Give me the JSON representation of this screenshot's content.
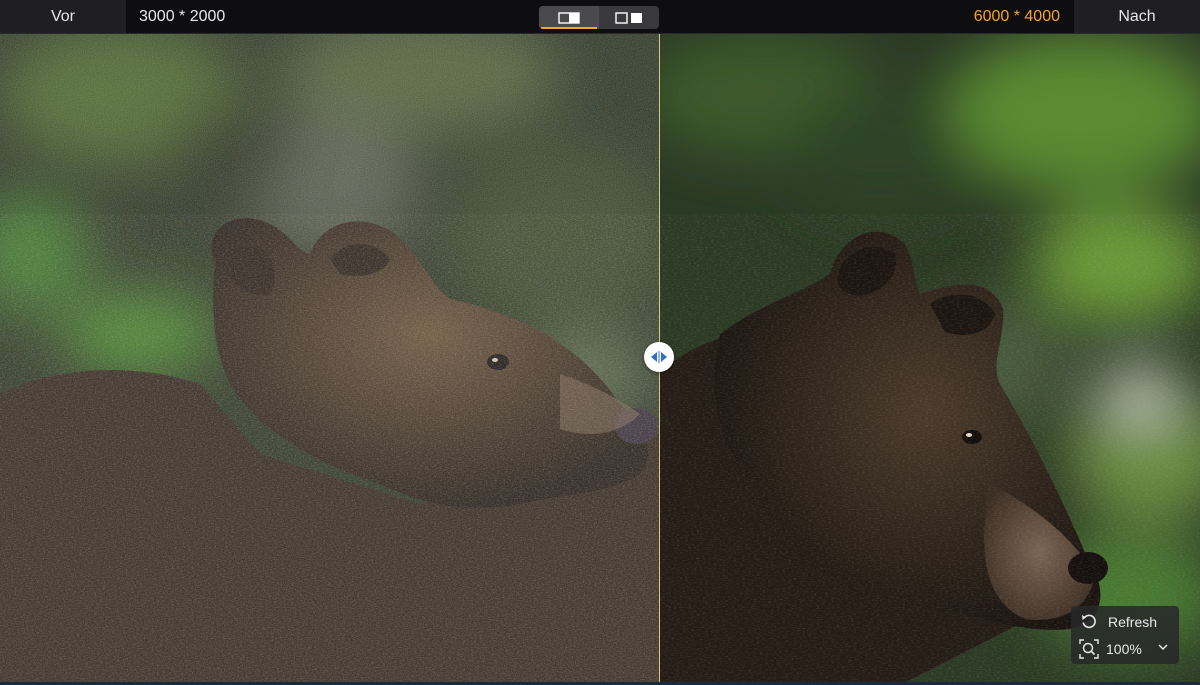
{
  "toolbar": {
    "before_label": "Vor",
    "before_resolution": "3000 * 2000",
    "after_label": "Nach",
    "after_resolution": "6000 * 4000",
    "accent_color": "#f5a623",
    "view_modes": [
      {
        "icon": "split-view-icon",
        "active": true
      },
      {
        "icon": "side-by-side-icon",
        "active": false
      }
    ]
  },
  "viewer": {
    "split_position_percent": 55,
    "handle_icon": "split-handle-arrows-icon"
  },
  "panel": {
    "refresh_label": "Refresh",
    "refresh_icon": "refresh-icon",
    "zoom_value": "100%",
    "zoom_icon": "zoom-icon",
    "zoom_dropdown_icon": "chevron-down-icon"
  }
}
